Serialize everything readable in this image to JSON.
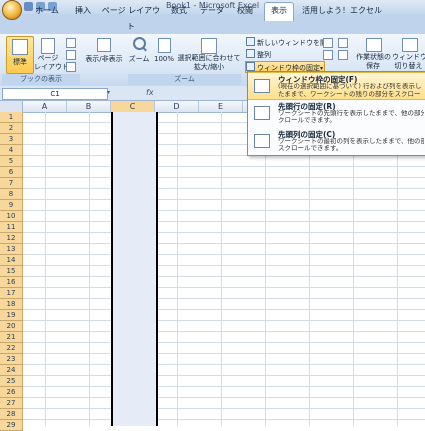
{
  "window": {
    "title": "Book1 - Microsoft Excel"
  },
  "tabs": [
    {
      "label": "ホーム"
    },
    {
      "label": "挿入"
    },
    {
      "label": "ページ レイアウト"
    },
    {
      "label": "数式"
    },
    {
      "label": "データ"
    },
    {
      "label": "校閲"
    },
    {
      "label": "表示",
      "active": true
    },
    {
      "label": "活用しよう！エクセル"
    }
  ],
  "ribbon": {
    "normal": "標準",
    "page_layout": "ページ\nレイアウト",
    "show_hide": "表示/非表示",
    "zoom": "ズーム",
    "zoom100": "100%",
    "zoom_selection": "選択範囲に合わせて\n拡大/縮小",
    "new_window": "新しいウィンドウを開く",
    "arrange": "整列",
    "freeze_panes": "ウィンドウ枠の固定",
    "save_workspace": "作業状態の\n保存",
    "switch_windows": "ウィンドウ\n切り替え",
    "group_workbook_views": "ブックの表示",
    "group_zoom": "ズーム"
  },
  "formula_bar": {
    "name_box": "C1",
    "fx": "fx"
  },
  "columns": [
    "A",
    "B",
    "C",
    "D",
    "E"
  ],
  "rows": [
    "1",
    "2",
    "3",
    "4",
    "5",
    "6",
    "7",
    "8",
    "9",
    "10",
    "11",
    "12",
    "13",
    "14",
    "15",
    "16",
    "17",
    "18",
    "19",
    "20",
    "21",
    "22",
    "23",
    "24",
    "25",
    "26",
    "27",
    "28",
    "29"
  ],
  "dropdown": [
    {
      "title": "ウィンドウ枠の固定(F)",
      "desc1": "(現在の選択範囲に基づいて) 行および列を表示したままで、ワークシートの残りの部分をスクロールできます。",
      "desc2": ""
    },
    {
      "title": "先頭行の固定(R)",
      "desc1": "ワークシートの先頭行を表示したままで、他の部分をス",
      "desc2": "クロールできます。"
    },
    {
      "title": "先頭列の固定(C)",
      "desc1": "ワークシートの最初の列を表示したままで、他の部分を",
      "desc2": "スクロールできます。"
    }
  ]
}
